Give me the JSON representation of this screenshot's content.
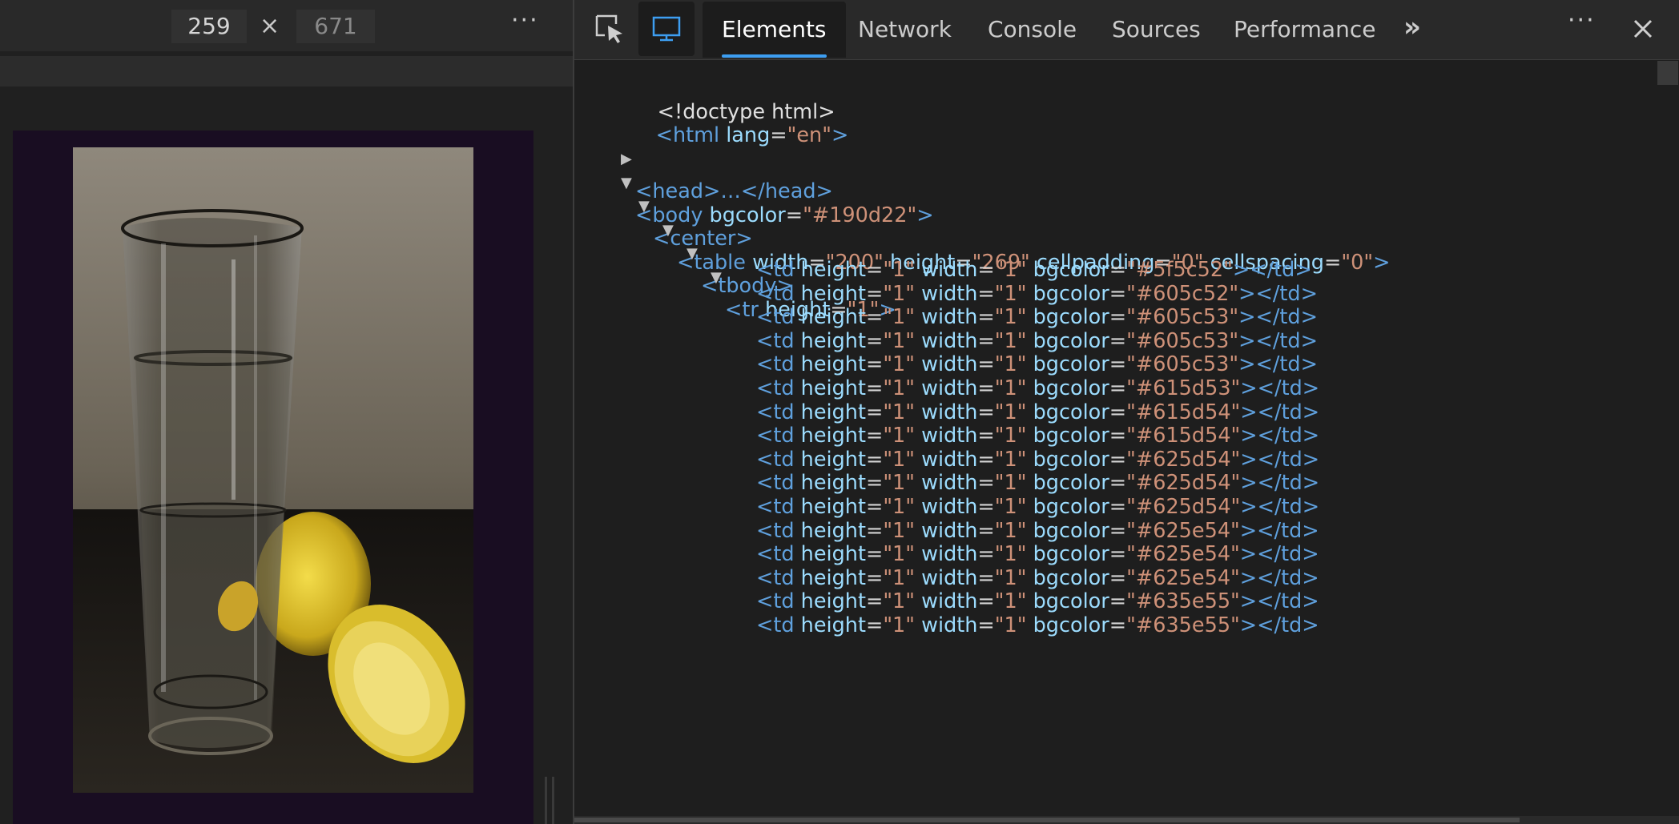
{
  "device": {
    "width_value": "259",
    "times_symbol": "×",
    "height_value": "671",
    "more_label": "···",
    "viewport_bg": "#190d22"
  },
  "toolbar": {
    "inspect_icon": "inspect-element-icon",
    "device_icon": "device-emulation-icon",
    "tabs": [
      "Elements",
      "Network",
      "Console",
      "Sources",
      "Performance"
    ],
    "active_tab": "Elements",
    "overflow_label": "»",
    "more_label": "···",
    "close_icon": "close-icon",
    "accent": "#3d9ef1"
  },
  "tree": {
    "doctype": "<!doctype html>",
    "html": {
      "open": "<html",
      "attr": "lang",
      "value": "\"en\"",
      "close": ">"
    },
    "head": {
      "text": "<head>…</head>"
    },
    "body": {
      "open": "<body",
      "attr": "bgcolor",
      "value": "\"#190d22\"",
      "close": ">"
    },
    "center": {
      "text": "<center>"
    },
    "table": {
      "open": "<table",
      "attrs": [
        {
          "name": "width",
          "value": "\"200\""
        },
        {
          "name": "height",
          "value": "\"269\""
        },
        {
          "name": "cellpadding",
          "value": "\"0\""
        },
        {
          "name": "cellspacing",
          "value": "\"0\""
        }
      ],
      "close": ">"
    },
    "tbody": {
      "text": "<tbody>"
    },
    "tr": {
      "open": "<tr",
      "attr": "height",
      "value": "\"1\"",
      "close": ">"
    },
    "td_rows": [
      "\"#5f5c52\"",
      "\"#605c52\"",
      "\"#605c53\"",
      "\"#605c53\"",
      "\"#605c53\"",
      "\"#615d53\"",
      "\"#615d54\"",
      "\"#615d54\"",
      "\"#625d54\"",
      "\"#625d54\"",
      "\"#625d54\"",
      "\"#625e54\"",
      "\"#625e54\"",
      "\"#625e54\"",
      "\"#635e55\"",
      "\"#635e55\""
    ],
    "td_parts": {
      "open": "<td",
      "height": "height",
      "height_val": "\"1\"",
      "width": "width",
      "width_val": "\"1\"",
      "bgcolor": "bgcolor",
      "close": "></td>"
    }
  }
}
